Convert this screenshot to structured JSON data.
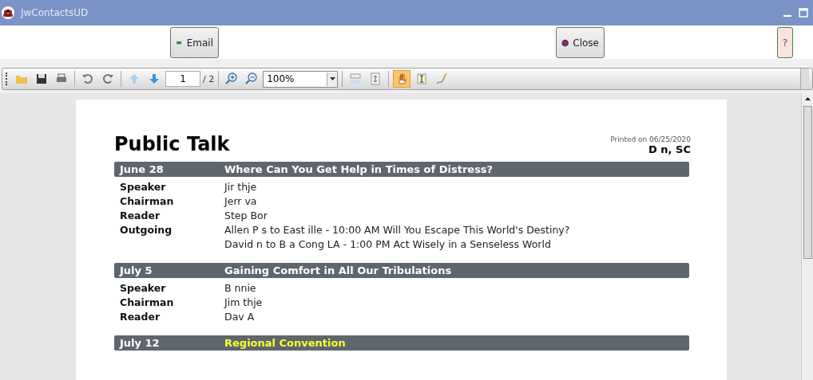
{
  "window": {
    "title": "JwContactsUD"
  },
  "action_buttons": [
    {
      "label": "Email",
      "kind": "email"
    },
    {
      "label": "Close",
      "kind": "close"
    },
    {
      "label": "?",
      "kind": "help"
    }
  ],
  "toolbar": {
    "tools_left": [
      [
        {
          "kind": "open",
          "selected": false
        },
        {
          "kind": "save",
          "selected": false
        },
        {
          "kind": "print",
          "selected": false
        }
      ],
      [
        {
          "kind": "undo",
          "selected": false
        },
        {
          "kind": "redo",
          "selected": false
        }
      ],
      [
        {
          "kind": "up",
          "selected": false
        },
        {
          "kind": "down",
          "selected": false
        }
      ]
    ],
    "page_field": "1",
    "page_total": "/ 2",
    "tools_mid": [
      {
        "kind": "zoomin",
        "selected": false
      },
      {
        "kind": "zoomout",
        "selected": false
      }
    ],
    "zoom": "100%",
    "tools_right": [
      [
        {
          "kind": "fitwidth",
          "selected": false
        },
        {
          "kind": "fitpage",
          "selected": false
        }
      ],
      [
        {
          "kind": "hand",
          "selected": true
        },
        {
          "kind": "textselect",
          "selected": false
        },
        {
          "kind": "draw",
          "selected": false
        }
      ]
    ]
  },
  "document": {
    "title": "Public Talk",
    "printed_on": "Printed on 06/25/2020",
    "location": "D    n, SC",
    "sections": [
      {
        "date": "June 28",
        "title": "Where Can You Get Help in Times of Distress?",
        "highlighted": false,
        "rows": [
          {
            "role": "Speaker",
            "lines": [
              "Jir   thje"
            ]
          },
          {
            "role": "Chairman",
            "lines": [
              "Jerr   va"
            ]
          },
          {
            "role": "Reader",
            "lines": [
              "Step   Bor"
            ]
          },
          {
            "role": "Outgoing",
            "lines": [
              "Allen P   s to East   ille - 10:00 AM  Will You Escape This World's Destiny?",
              "David   n to B   a Cong LA - 1:00 PM  Act Wisely in a Senseless World"
            ]
          }
        ]
      },
      {
        "date": "July 5",
        "title": "Gaining Comfort in All Our Tribulations",
        "highlighted": false,
        "rows": [
          {
            "role": "Speaker",
            "lines": [
              "B   nnie"
            ]
          },
          {
            "role": "Chairman",
            "lines": [
              "Jim   thje"
            ]
          },
          {
            "role": "Reader",
            "lines": [
              "Dav   A"
            ]
          }
        ]
      },
      {
        "date": "July 12",
        "title": "Regional Convention",
        "highlighted": true
      }
    ]
  }
}
